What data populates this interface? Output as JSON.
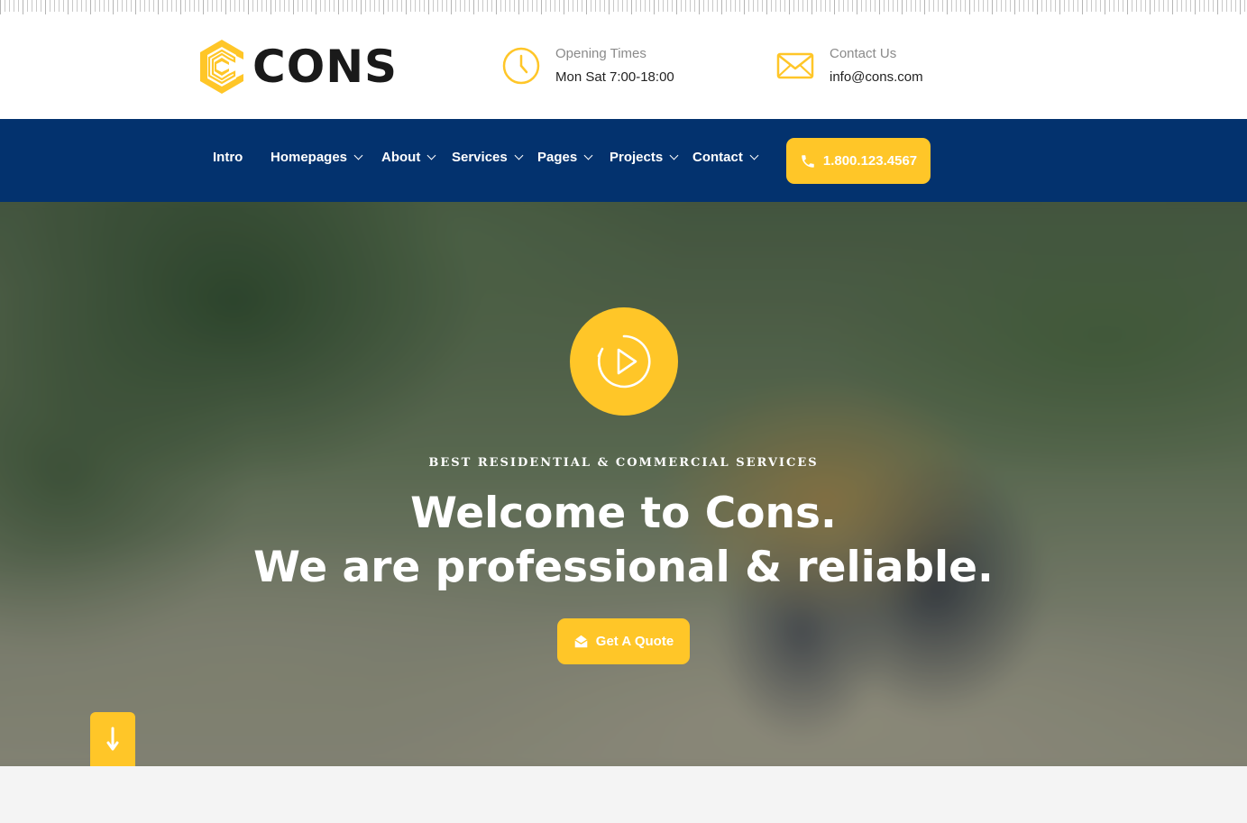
{
  "brand": {
    "name": "CONS",
    "accent_color": "#ffc628",
    "nav_color": "#03326e"
  },
  "header": {
    "hours": {
      "icon": "clock-icon",
      "label": "Opening Times",
      "value": "Mon Sat 7:00-18:00"
    },
    "contact": {
      "icon": "envelope-icon",
      "label": "Contact Us",
      "value": "info@cons.com"
    }
  },
  "nav": {
    "items": [
      {
        "label": "Intro",
        "has_dropdown": false
      },
      {
        "label": "Homepages",
        "has_dropdown": true
      },
      {
        "label": "About",
        "has_dropdown": true
      },
      {
        "label": "Services",
        "has_dropdown": true
      },
      {
        "label": "Pages",
        "has_dropdown": true
      },
      {
        "label": "Projects",
        "has_dropdown": true
      },
      {
        "label": "Contact",
        "has_dropdown": true
      }
    ],
    "phone": "1.800.123.4567"
  },
  "hero": {
    "eyebrow": "BEST RESIDENTIAL & COMMERCIAL SERVICES",
    "title_line1": "Welcome to Cons.",
    "title_line2": "We are professional & reliable.",
    "cta_label": "Get A Quote"
  }
}
